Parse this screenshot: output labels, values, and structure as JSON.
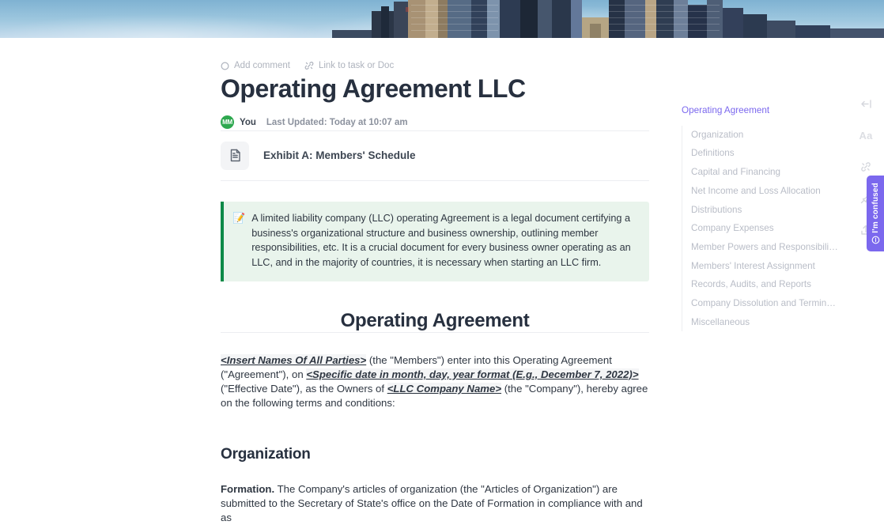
{
  "banner": {
    "alt": "city skyscrapers against blue sky"
  },
  "meta": {
    "add_comment": "Add comment",
    "add_comment_icon": "comment-circle-icon",
    "link_task": "Link to task or Doc",
    "link_task_icon": "link-diagonal-icon"
  },
  "header": {
    "title": "Operating Agreement LLC",
    "author_initials": "MM",
    "author": "You",
    "last_updated": "Last Updated: Today at 10:07 am"
  },
  "subdoc": {
    "icon": "document-icon",
    "name": "Exhibit A: Members' Schedule"
  },
  "callout": {
    "emoji": "📝",
    "accent_color": "#0d8a48",
    "background_color": "#e9f4ec",
    "text": "A limited liability company (LLC) operating Agreement is a legal document certifying a business's organizational structure and business ownership, outlining member responsibilities, etc. It is a crucial document for every business owner operating as an LLC, and in the majority of countries, it is necessary when starting an LLC firm."
  },
  "document": {
    "heading": "Operating Agreement",
    "intro": {
      "ph1": "<Insert Names Of All Parties>",
      "t1": " (the \"Members\") enter into this Operating Agreement (\"Agreement\"), on ",
      "ph2": "<Specific date in month, day, year format (E.g., December 7, 2022)>",
      "t2": " (\"Effective Date\"), as the Owners of ",
      "ph3": "<LLC Company Name>",
      "t3": " (the \"Company\"), hereby agree on the following terms and conditions:"
    },
    "section_heading": "Organization",
    "clause_label": "Formation.",
    "clause_text": " The Company's articles of organization (the \"Articles of Organization\") are submitted to the Secretary of State's office on the Date of Formation in compliance with and as"
  },
  "toc": {
    "root": "Operating Agreement",
    "active_color": "#7b68ee",
    "items": [
      {
        "label": "Organization"
      },
      {
        "label": "Definitions"
      },
      {
        "label": "Capital and Financing"
      },
      {
        "label": "Net Income and Loss Allocation"
      },
      {
        "label": "Distributions"
      },
      {
        "label": "Company Expenses"
      },
      {
        "label": "Member Powers and Responsibiliti…"
      },
      {
        "label": "Members' Interest Assignment"
      },
      {
        "label": "Records, Audits, and Reports"
      },
      {
        "label": "Company Dissolution and Termina…"
      },
      {
        "label": "Miscellaneous"
      }
    ]
  },
  "rail": {
    "items": [
      {
        "name": "collapse-panel-icon",
        "glyph": "←|"
      },
      {
        "name": "font-size-icon",
        "glyph": "Aa"
      },
      {
        "name": "link-diagonal-icon",
        "glyph": ""
      },
      {
        "name": "pin-icon",
        "glyph": ""
      },
      {
        "name": "share-icon",
        "glyph": ""
      }
    ]
  },
  "feedback_tab": {
    "label": "I'm confused",
    "icon": "info-circle-icon",
    "color": "#7b68ee"
  }
}
